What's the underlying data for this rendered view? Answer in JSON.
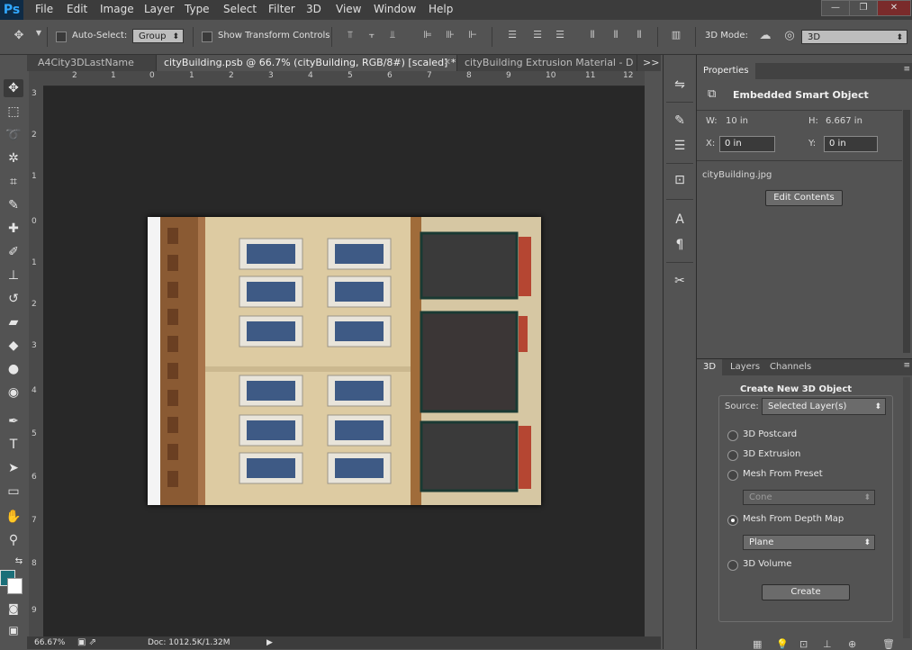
{
  "app": {
    "logo": "Ps"
  },
  "menu": [
    "File",
    "Edit",
    "Image",
    "Layer",
    "Type",
    "Select",
    "Filter",
    "3D",
    "View",
    "Window",
    "Help"
  ],
  "window_controls": {
    "minimize": "—",
    "restore": "❐",
    "close": "✕"
  },
  "options_bar": {
    "auto_select_label": "Auto-Select:",
    "auto_select_value": "Group",
    "show_transform_label": "Show Transform Controls",
    "mode_label": "3D Mode:",
    "mode_value": "3D"
  },
  "tabs": [
    {
      "label": "A4City3DLastName",
      "active": false
    },
    {
      "label": "cityBuilding.psb @ 66.7% (cityBuilding, RGB/8#) [scaled] *",
      "active": true
    },
    {
      "label": "cityBuilding Extrusion Material - D",
      "active": false
    }
  ],
  "tabs_overflow": ">>",
  "ruler": {
    "top": [
      "2",
      "1",
      "0",
      "1",
      "2",
      "3",
      "4",
      "5",
      "6",
      "7",
      "8",
      "9",
      "10",
      "11",
      "12"
    ],
    "left": [
      "3",
      "2",
      "1",
      "0",
      "1",
      "2",
      "3",
      "4",
      "5",
      "6",
      "7",
      "8",
      "9"
    ]
  },
  "status": {
    "zoom": "66.67%",
    "doc": "Doc: 1012.5K/1.32M",
    "arrow": "▶"
  },
  "properties": {
    "tab": "Properties",
    "title": "Embedded Smart Object",
    "w_label": "W:",
    "w_value": "10 in",
    "h_label": "H:",
    "h_value": "6.667 in",
    "x_label": "X:",
    "x_value": "0 in",
    "y_label": "Y:",
    "y_value": "0 in",
    "filename": "cityBuilding.jpg",
    "edit_button": "Edit Contents"
  },
  "panel3d": {
    "tabs": [
      "3D",
      "Layers",
      "Channels"
    ],
    "group_title": "Create New 3D Object",
    "source_label": "Source:",
    "source_value": "Selected Layer(s)",
    "options": [
      {
        "label": "3D Postcard",
        "selected": false
      },
      {
        "label": "3D Extrusion",
        "selected": false
      },
      {
        "label": "Mesh From Preset",
        "selected": false
      },
      {
        "label": "Mesh From Depth Map",
        "selected": true
      },
      {
        "label": "3D Volume",
        "selected": false
      }
    ],
    "preset_value": "Cone",
    "depth_value": "Plane",
    "create_button": "Create"
  },
  "colors": {
    "foreground": "#1b6f79",
    "background": "#ffffff",
    "accent": "#31a8ff"
  }
}
